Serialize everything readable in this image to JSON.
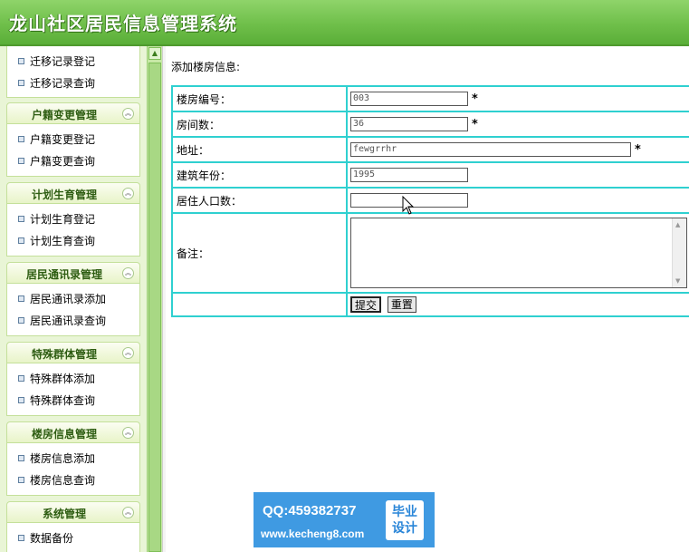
{
  "header": {
    "title": "龙山社区居民信息管理系统"
  },
  "sidebar": {
    "top_items": [
      "迁移记录登记",
      "迁移记录查询"
    ],
    "groups": [
      {
        "title": "户籍变更管理",
        "items": [
          "户籍变更登记",
          "户籍变更查询"
        ]
      },
      {
        "title": "计划生育管理",
        "items": [
          "计划生育登记",
          "计划生育查询"
        ]
      },
      {
        "title": "居民通讯录管理",
        "items": [
          "居民通讯录添加",
          "居民通讯录查询"
        ]
      },
      {
        "title": "特殊群体管理",
        "items": [
          "特殊群体添加",
          "特殊群体查询"
        ]
      },
      {
        "title": "楼房信息管理",
        "items": [
          "楼房信息添加",
          "楼房信息查询"
        ]
      },
      {
        "title": "系统管理",
        "items": [
          "数据备份"
        ]
      }
    ]
  },
  "main": {
    "caption": "添加楼房信息:",
    "fields": [
      {
        "label": "楼房编号：",
        "value": "003",
        "required": "*"
      },
      {
        "label": "房间数：",
        "value": "36",
        "required": "*"
      },
      {
        "label": "地址：",
        "value": "fewgrrhr",
        "required": "*"
      },
      {
        "label": "建筑年份：",
        "value": "1995",
        "required": ""
      },
      {
        "label": "居住人口数：",
        "value": "",
        "required": ""
      },
      {
        "label": "备注：",
        "value": "",
        "required": ""
      }
    ],
    "buttons": {
      "submit": "提交",
      "reset": "重置"
    }
  },
  "watermark": {
    "qq": "QQ:459382737",
    "url": "www.kecheng8.com",
    "badge_line1": "毕业",
    "badge_line2": "设计"
  }
}
